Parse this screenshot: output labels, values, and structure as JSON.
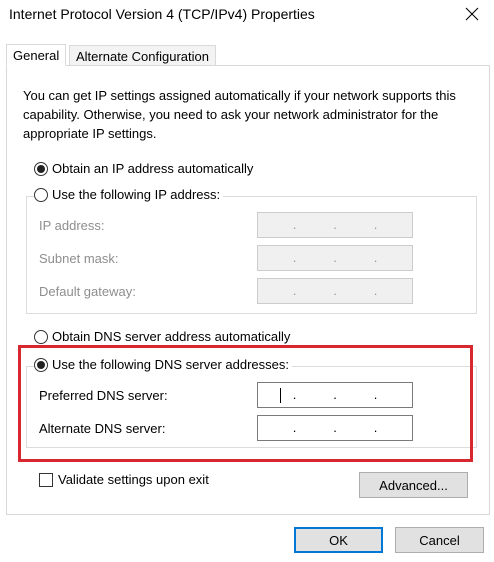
{
  "window": {
    "title": "Internet Protocol Version 4 (TCP/IPv4) Properties"
  },
  "icons": {
    "close": "close-icon"
  },
  "tabs": [
    {
      "label": "General",
      "active": true
    },
    {
      "label": "Alternate Configuration",
      "active": false
    }
  ],
  "description": "You can get IP settings assigned automatically if your network supports this capability. Otherwise, you need to ask your network administrator for the appropriate IP settings.",
  "ip": {
    "auto_label": "Obtain an IP address automatically",
    "manual_label": "Use the following IP address:",
    "selected": "auto",
    "fields": [
      {
        "label": "IP address:",
        "value": ". . ."
      },
      {
        "label": "Subnet mask:",
        "value": ". . ."
      },
      {
        "label": "Default gateway:",
        "value": ". . ."
      }
    ]
  },
  "dns": {
    "auto_label": "Obtain DNS server address automatically",
    "manual_label": "Use the following DNS server addresses:",
    "selected": "manual",
    "fields": [
      {
        "label": "Preferred DNS server:",
        "value": ". . ."
      },
      {
        "label": "Alternate DNS server:",
        "value": ". . ."
      }
    ]
  },
  "validate": {
    "label": "Validate settings upon exit",
    "checked": false
  },
  "buttons": {
    "advanced": "Advanced...",
    "ok": "OK",
    "cancel": "Cancel"
  },
  "colors": {
    "highlight": "#d7282f",
    "default_button_border": "#0078d7"
  }
}
